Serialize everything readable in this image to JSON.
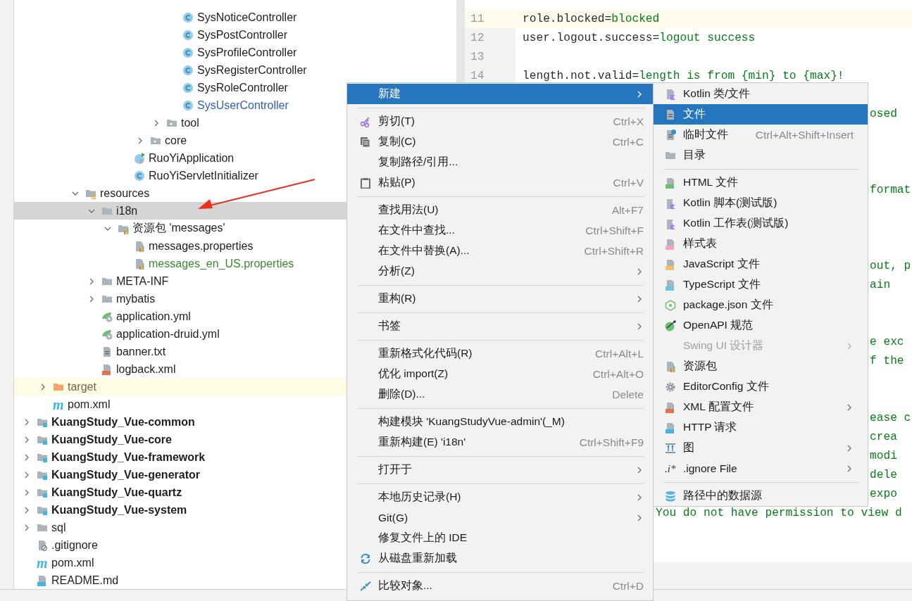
{
  "tree": [
    {
      "children": [
        {
          "children": [
            {
              "children": [
                {
                  "children": [
                    {
                      "children": [
                        {
                          "children": [
                            {
                              "children": [
                                {
                                  "children": [
                                    {
                                      "children": [
                                        {
                                          "label": "SysNoticeController",
                                          "kind": "class",
                                          "selected": false
                                        },
                                        {
                                          "label": "SysPostController",
                                          "kind": "class",
                                          "selected": false
                                        },
                                        {
                                          "label": "SysProfileController",
                                          "kind": "class",
                                          "selected": false
                                        },
                                        {
                                          "label": "SysRegisterController",
                                          "kind": "class",
                                          "selected": false
                                        },
                                        {
                                          "label": "SysRoleController",
                                          "kind": "class",
                                          "selected": false
                                        },
                                        {
                                          "label": "SysUserController",
                                          "kind": "class",
                                          "selected": false,
                                          "color": "#2f5fc4"
                                        }
                                      ]
                                    },
                                    {
                                      "label": "tool",
                                      "kind": "package",
                                      "expanded": false,
                                      "selected": false
                                    }
                                  ]
                                },
                                {
                                  "label": "core",
                                  "kind": "package",
                                  "expanded": false,
                                  "selected": false
                                }
                              ]
                            },
                            {
                              "label": "RuoYiApplication",
                              "kind": "app-class",
                              "selected": false
                            },
                            {
                              "label": "RuoYiServletInitializer",
                              "kind": "class",
                              "selected": false
                            }
                          ]
                        }
                      ]
                    }
                  ]
                },
                {
                  "label": "resources",
                  "kind": "resources",
                  "expanded": true,
                  "selected": false,
                  "children": [
                    {
                      "label": "i18n",
                      "kind": "folder",
                      "expanded": true,
                      "selected": true,
                      "children": [
                        {
                          "label": "资源包 'messages'",
                          "kind": "bundle",
                          "expanded": true,
                          "selected": false,
                          "children": [
                            {
                              "label": "messages.properties",
                              "kind": "properties",
                              "selected": false
                            },
                            {
                              "label": "messages_en_US.properties",
                              "kind": "properties",
                              "selected": false,
                              "color": "#3c8a2f"
                            }
                          ]
                        }
                      ]
                    },
                    {
                      "label": "META-INF",
                      "kind": "folder",
                      "expanded": false,
                      "selected": false
                    },
                    {
                      "label": "mybatis",
                      "kind": "folder",
                      "expanded": false,
                      "selected": false
                    },
                    {
                      "label": "application.yml",
                      "kind": "yml",
                      "selected": false
                    },
                    {
                      "label": "application-druid.yml",
                      "kind": "yml",
                      "selected": false
                    },
                    {
                      "label": "banner.txt",
                      "kind": "text",
                      "selected": false
                    },
                    {
                      "label": "logback.xml",
                      "kind": "xml",
                      "selected": false
                    }
                  ]
                }
              ]
            }
          ]
        },
        {
          "label": "target",
          "kind": "excluded",
          "expanded": false,
          "selected": false,
          "color": "#7a6445"
        },
        {
          "label": "pom.xml",
          "kind": "maven",
          "icon_text": "m",
          "selected": false
        }
      ]
    },
    {
      "label": "KuangStudy_Vue-common",
      "kind": "module",
      "expanded": false,
      "selected": false
    },
    {
      "label": "KuangStudy_Vue-core",
      "kind": "module",
      "expanded": false,
      "selected": false
    },
    {
      "label": "KuangStudy_Vue-framework",
      "kind": "module",
      "expanded": false,
      "selected": false
    },
    {
      "label": "KuangStudy_Vue-generator",
      "kind": "module",
      "expanded": false,
      "selected": false
    },
    {
      "label": "KuangStudy_Vue-quartz",
      "kind": "module",
      "expanded": false,
      "selected": false
    },
    {
      "label": "KuangStudy_Vue-system",
      "kind": "module",
      "expanded": false,
      "selected": false
    },
    {
      "label": "sql",
      "kind": "folder",
      "expanded": false,
      "selected": false
    },
    {
      "label": ".gitignore",
      "kind": "gitignore",
      "selected": false
    },
    {
      "label": "pom.xml",
      "kind": "maven",
      "icon_text": "m",
      "selected": false
    },
    {
      "label": "README.md",
      "kind": "md",
      "selected": false
    }
  ],
  "editor": {
    "lines": [
      {
        "kind": "code",
        "number": "11",
        "key": "role.blocked",
        "operator": "=",
        "value": "blocked",
        "current": true
      },
      {
        "kind": "code",
        "number": "12",
        "key": "user.logout.success",
        "operator": "=",
        "value": "logout success",
        "current": false
      },
      {
        "kind": "code",
        "number": "13",
        "current": false
      },
      {
        "kind": "code",
        "number": "14",
        "key": "length.not.valid",
        "operator": "=",
        "value": "length is from {min} to {max}!",
        "current": false
      },
      {
        "kind": "covered"
      },
      {
        "kind": "right-fragment",
        "value": "osed"
      },
      {
        "kind": "covered"
      },
      {
        "kind": "covered"
      },
      {
        "kind": "covered"
      },
      {
        "kind": "right-fragment",
        "value": "format"
      },
      {
        "kind": "covered"
      },
      {
        "kind": "covered"
      },
      {
        "kind": "covered"
      },
      {
        "kind": "right-fragment",
        "value": "out, p"
      },
      {
        "kind": "right-fragment",
        "value": "ain"
      },
      {
        "kind": "covered"
      },
      {
        "kind": "covered"
      },
      {
        "kind": "right-fragment",
        "value": "e exc"
      },
      {
        "kind": "right-fragment",
        "value": "f the"
      },
      {
        "kind": "covered"
      },
      {
        "kind": "covered"
      },
      {
        "kind": "right-fragment",
        "value": "ease c"
      },
      {
        "kind": "right-fragment",
        "value": "crea"
      },
      {
        "kind": "right-fragment",
        "value": "modi"
      },
      {
        "kind": "right-fragment",
        "value": "dele"
      },
      {
        "kind": "right-fragment",
        "value": "expo"
      },
      {
        "kind": "left-cut",
        "value": "You do not have permission to view d"
      }
    ]
  },
  "context_menu": {
    "items": [
      {
        "kind": "item",
        "label": "新建",
        "submenu": true,
        "selected": true,
        "disabled": false
      },
      {
        "kind": "separator"
      },
      {
        "kind": "scissors",
        "label": "剪切(T)",
        "shortcut": "Ctrl+X",
        "selected": false,
        "disabled": false
      },
      {
        "kind": "copy",
        "label": "复制(C)",
        "shortcut": "Ctrl+C",
        "selected": false,
        "disabled": false
      },
      {
        "kind": "item",
        "label": "复制路径/引用...",
        "selected": false,
        "disabled": false
      },
      {
        "kind": "paste",
        "label": "粘贴(P)",
        "shortcut": "Ctrl+V",
        "selected": false,
        "disabled": false
      },
      {
        "kind": "separator"
      },
      {
        "kind": "item",
        "label": "查找用法(U)",
        "shortcut": "Alt+F7",
        "selected": false,
        "disabled": false
      },
      {
        "kind": "item",
        "label": "在文件中查找...",
        "shortcut": "Ctrl+Shift+F",
        "selected": false,
        "disabled": false
      },
      {
        "kind": "item",
        "label": "在文件中替换(A)...",
        "shortcut": "Ctrl+Shift+R",
        "selected": false,
        "disabled": false
      },
      {
        "kind": "item",
        "label": "分析(Z)",
        "submenu": true,
        "selected": false,
        "disabled": false
      },
      {
        "kind": "separator"
      },
      {
        "kind": "item",
        "label": "重构(R)",
        "submenu": true,
        "selected": false,
        "disabled": false
      },
      {
        "kind": "separator"
      },
      {
        "kind": "item",
        "label": "书签",
        "submenu": true,
        "selected": false,
        "disabled": false
      },
      {
        "kind": "separator"
      },
      {
        "kind": "item",
        "label": "重新格式化代码(R)",
        "shortcut": "Ctrl+Alt+L",
        "selected": false,
        "disabled": false
      },
      {
        "kind": "item",
        "label": "优化 import(Z)",
        "shortcut": "Ctrl+Alt+O",
        "selected": false,
        "disabled": false
      },
      {
        "kind": "item",
        "label": "删除(D)...",
        "shortcut": "Delete",
        "selected": false,
        "disabled": false
      },
      {
        "kind": "separator"
      },
      {
        "kind": "item",
        "label": "构建模块 'KuangStudyVue-admin'(_M)",
        "selected": false,
        "disabled": false
      },
      {
        "kind": "item",
        "label": "重新构建(E) 'i18n'",
        "shortcut": "Ctrl+Shift+F9",
        "selected": false,
        "disabled": false
      },
      {
        "kind": "separator"
      },
      {
        "kind": "item",
        "label": "打开于",
        "submenu": true,
        "selected": false,
        "disabled": false
      },
      {
        "kind": "separator"
      },
      {
        "kind": "item",
        "label": "本地历史记录(H)",
        "submenu": true,
        "selected": false,
        "disabled": false
      },
      {
        "kind": "item",
        "label": "Git(G)",
        "submenu": true,
        "selected": false,
        "disabled": false
      },
      {
        "kind": "item",
        "label": "修复文件上的 IDE",
        "selected": false,
        "disabled": false
      },
      {
        "kind": "reload",
        "label": "从磁盘重新加载",
        "selected": false,
        "disabled": false
      },
      {
        "kind": "separator"
      },
      {
        "kind": "compare",
        "label": "比较对象...",
        "shortcut": "Ctrl+D",
        "selected": false,
        "disabled": false
      }
    ]
  },
  "new_submenu": {
    "items": [
      {
        "kind": "kotlin",
        "label": "Kotlin 类/文件",
        "selected": false,
        "disabled": false
      },
      {
        "kind": "file",
        "label": "文件",
        "selected": true,
        "disabled": false
      },
      {
        "kind": "scratch",
        "label": "临时文件",
        "shortcut": "Ctrl+Alt+Shift+Insert",
        "selected": false,
        "disabled": false
      },
      {
        "kind": "folder",
        "label": "目录",
        "selected": false,
        "disabled": false
      },
      {
        "kind": "separator"
      },
      {
        "kind": "html",
        "label": "HTML 文件",
        "selected": false,
        "disabled": false
      },
      {
        "kind": "kscript",
        "label": "Kotlin 脚本(测试版)",
        "selected": false,
        "disabled": false
      },
      {
        "kind": "kscript",
        "label": "Kotlin 工作表(测试版)",
        "selected": false,
        "disabled": false
      },
      {
        "kind": "css",
        "label": "样式表",
        "selected": false,
        "disabled": false
      },
      {
        "kind": "js",
        "label": "JavaScript 文件",
        "selected": false,
        "disabled": false
      },
      {
        "kind": "ts",
        "label": "TypeScript 文件",
        "selected": false,
        "disabled": false
      },
      {
        "kind": "node",
        "label": "package.json 文件",
        "selected": false,
        "disabled": false
      },
      {
        "kind": "openapi",
        "label": "OpenAPI 规范",
        "selected": false,
        "disabled": false
      },
      {
        "kind": "item",
        "label": "Swing UI 设计器",
        "submenu": true,
        "selected": false,
        "disabled": true
      },
      {
        "kind": "bundle-file",
        "label": "资源包",
        "selected": false,
        "disabled": false
      },
      {
        "kind": "gear",
        "label": "EditorConfig 文件",
        "selected": false,
        "disabled": false
      },
      {
        "kind": "xml",
        "label": "XML 配置文件",
        "submenu": true,
        "selected": false,
        "disabled": false
      },
      {
        "kind": "http",
        "label": "HTTP 请求",
        "selected": false,
        "disabled": false
      },
      {
        "kind": "diagram",
        "label": "图",
        "submenu": true,
        "selected": false,
        "disabled": false
      },
      {
        "kind": "ignore",
        "label": ".ignore File",
        "icon_text": ".i*",
        "submenu": true,
        "selected": false,
        "disabled": false
      },
      {
        "kind": "separator"
      },
      {
        "kind": "database",
        "label": "路径中的数据源",
        "selected": false,
        "disabled": false
      }
    ]
  }
}
